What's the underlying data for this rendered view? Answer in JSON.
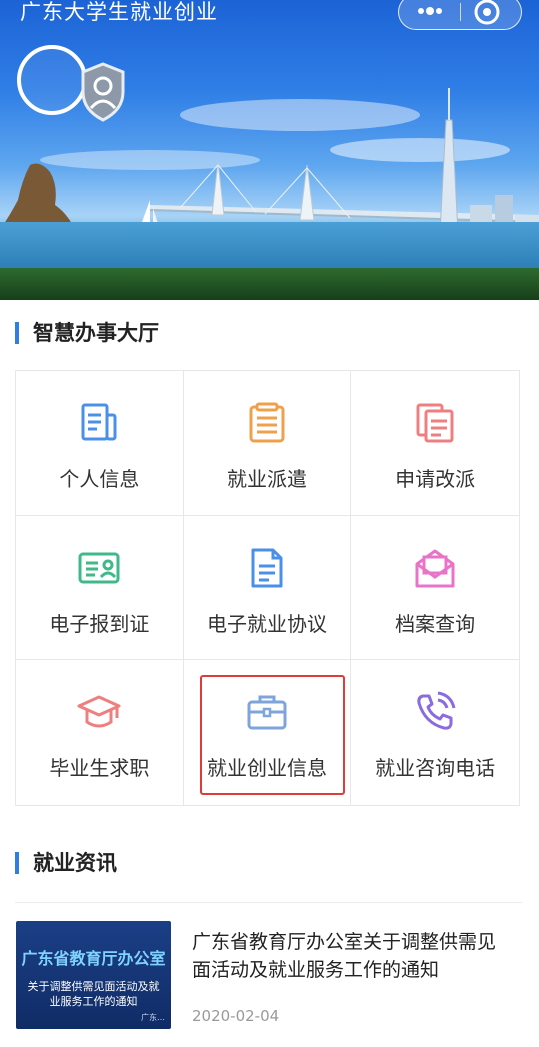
{
  "header": {
    "title": "广东大学生就业创业",
    "menu_icon": "more-dots-icon",
    "close_icon": "target-icon"
  },
  "banner": {
    "avatar_icon": "avatar-placeholder",
    "badge_icon": "verified-user-badge-icon"
  },
  "hall": {
    "section_title": "智慧办事大厅",
    "items": [
      {
        "label": "个人信息",
        "icon": "document-icon",
        "color": "#4a8fe8"
      },
      {
        "label": "就业派遣",
        "icon": "list-icon",
        "color": "#f0a04b"
      },
      {
        "label": "申请改派",
        "icon": "copy-document-icon",
        "color": "#ef7f7f"
      },
      {
        "label": "电子报到证",
        "icon": "id-card-icon",
        "color": "#3fb98a"
      },
      {
        "label": "电子就业协议",
        "icon": "file-text-icon",
        "color": "#4a8fe8"
      },
      {
        "label": "档案查询",
        "icon": "envelope-icon",
        "color": "#e873c9"
      },
      {
        "label": "毕业生求职",
        "icon": "graduation-cap-icon",
        "color": "#ef7f7f"
      },
      {
        "label": "就业创业信息",
        "icon": "briefcase-icon",
        "color": "#7ea4db"
      },
      {
        "label": "就业咨询电话",
        "icon": "phone-call-icon",
        "color": "#8a6be0"
      }
    ],
    "highlight_color": "#e03a3a"
  },
  "news": {
    "section_title": "就业资讯",
    "items": [
      {
        "thumb_title": "广东省教育厅办公室",
        "thumb_subtitle": "关于调整供需见面活动及就业服务工作的通知",
        "thumb_source": "广东…",
        "title": "广东省教育厅办公室关于调整供需见面活动及就业服务工作的通知",
        "date": "2020-02-04"
      }
    ]
  },
  "colors": {
    "accent": "#2f7ee6",
    "text": "#222222",
    "muted": "#999999"
  }
}
